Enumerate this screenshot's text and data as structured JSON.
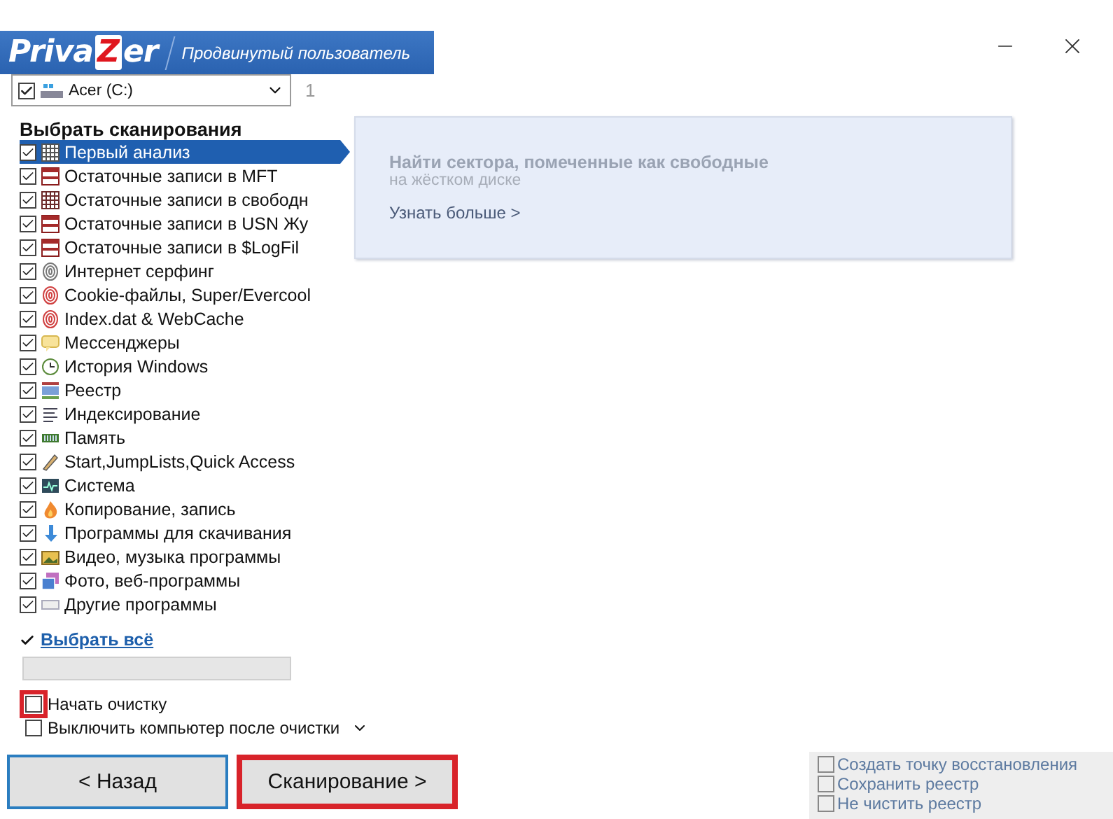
{
  "header": {
    "logo": [
      "Priva",
      "Z",
      "er"
    ],
    "subtitle": "Продвинутый пользователь"
  },
  "drive": {
    "checked": true,
    "label": "Acer (C:)",
    "count": "1"
  },
  "scan_heading": "Выбрать сканирования",
  "scans": [
    {
      "label": "Первый анализ",
      "kind": "grid",
      "checked": true,
      "selected": true
    },
    {
      "label": "Остаточные записи в  MFT",
      "kind": "records",
      "checked": true,
      "selected": false
    },
    {
      "label": "Остаточные записи в свободн",
      "kind": "grid-dark",
      "checked": true,
      "selected": false
    },
    {
      "label": "Остаточные записи в USN Жу",
      "kind": "records",
      "checked": true,
      "selected": false
    },
    {
      "label": "Остаточные записи в  $LogFil",
      "kind": "records",
      "checked": true,
      "selected": false
    },
    {
      "label": "Интернет серфинг",
      "kind": "fingerprint-grey",
      "checked": true,
      "selected": false
    },
    {
      "label": "Cookie-файлы, Super/Evercool",
      "kind": "fingerprint-red",
      "checked": true,
      "selected": false
    },
    {
      "label": "Index.dat & WebCache",
      "kind": "fingerprint-red",
      "checked": true,
      "selected": false
    },
    {
      "label": "Мессенджеры",
      "kind": "chat",
      "checked": true,
      "selected": false
    },
    {
      "label": "История Windows",
      "kind": "history",
      "checked": true,
      "selected": false
    },
    {
      "label": "Реестр",
      "kind": "registry",
      "checked": true,
      "selected": false
    },
    {
      "label": "Индексирование",
      "kind": "index",
      "checked": true,
      "selected": false
    },
    {
      "label": "Память",
      "kind": "memory",
      "checked": true,
      "selected": false
    },
    {
      "label": "Start,JumpLists,Quick Access",
      "kind": "pen",
      "checked": true,
      "selected": false
    },
    {
      "label": "Система",
      "kind": "system",
      "checked": true,
      "selected": false
    },
    {
      "label": "Копирование, запись",
      "kind": "fire",
      "checked": true,
      "selected": false
    },
    {
      "label": "Программы для скачивания",
      "kind": "download",
      "checked": true,
      "selected": false
    },
    {
      "label": "Видео, музыка программы",
      "kind": "video",
      "checked": true,
      "selected": false
    },
    {
      "label": "Фото, веб-программы",
      "kind": "photo",
      "checked": true,
      "selected": false
    },
    {
      "label": "Другие программы",
      "kind": "other",
      "checked": true,
      "selected": false
    }
  ],
  "info": {
    "title": "Найти сектора, помеченные как свободные",
    "subtitle": "на жёстком диске",
    "link": "Узнать больше >"
  },
  "select_all": "Выбрать всё",
  "options": [
    {
      "label": "Начать очистку",
      "checked": false,
      "highlighted": true,
      "kind": "plain"
    },
    {
      "label": "Выключить компьютер после очистки",
      "checked": false,
      "kind": "dropdown"
    }
  ],
  "buttons": [
    {
      "label": "< Назад",
      "kind": "back",
      "highlighted": false
    },
    {
      "label": "Сканирование >",
      "kind": "primary",
      "highlighted": true
    }
  ],
  "extra_options": [
    {
      "label": "Создать точку восстановления",
      "checked": false
    },
    {
      "label": "Сохранить реестр",
      "checked": false
    },
    {
      "label": "Не чистить реестр",
      "checked": false
    }
  ]
}
